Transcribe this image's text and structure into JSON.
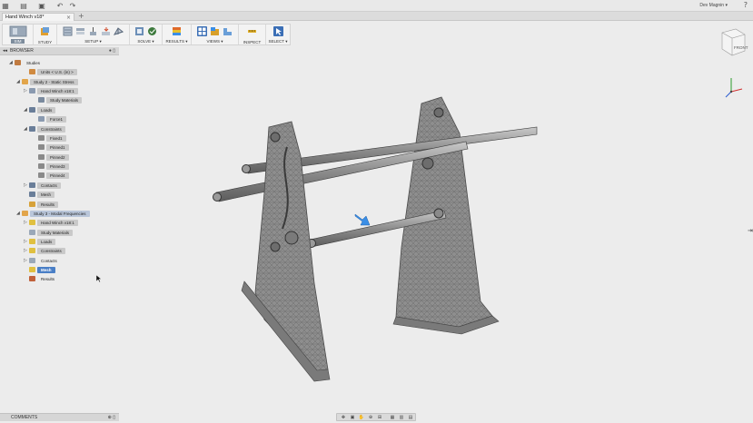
{
  "app": {
    "user_name": "Dev Magnin",
    "user_caret": "▾",
    "help_caret": "▾"
  },
  "document": {
    "tab_title": "Hand Winch v18*",
    "tab_close": "×",
    "new_tab": "+"
  },
  "ribbon": {
    "workspace_label": "SIM",
    "groups": [
      {
        "label": "STUDY"
      },
      {
        "label": "SETUP ▾"
      },
      {
        "label": "SOLVE ▾"
      },
      {
        "label": "RESULTS ▾"
      },
      {
        "label": "VIEWS ▾"
      },
      {
        "label": "INSPECT"
      },
      {
        "label": "SELECT ▾"
      }
    ],
    "accent_color": "#3b6fb6"
  },
  "browser": {
    "title": "BROWSER",
    "tree": [
      {
        "label": "Studies",
        "icon": "studies-icon"
      },
      {
        "label": "Units < U.S. (in) >",
        "icon": "units-icon"
      },
      {
        "label": "Study 2 - Static Stress",
        "icon": "study-icon"
      },
      {
        "label": "Hand Winch v18:1",
        "icon": "component-icon"
      },
      {
        "label": "Study Materials",
        "icon": "materials-icon"
      },
      {
        "label": "Loads",
        "icon": "loads-icon"
      },
      {
        "label": "Force1",
        "icon": "force-icon"
      },
      {
        "label": "Constraints",
        "icon": "constraints-icon"
      },
      {
        "label": "Fixed1",
        "icon": "constraint-icon"
      },
      {
        "label": "Pinned1",
        "icon": "constraint-icon"
      },
      {
        "label": "Pinned2",
        "icon": "constraint-icon"
      },
      {
        "label": "Pinned3",
        "icon": "constraint-icon"
      },
      {
        "label": "Pinned4",
        "icon": "constraint-icon"
      },
      {
        "label": "Contacts",
        "icon": "contacts-icon"
      },
      {
        "label": "Mesh",
        "icon": "mesh-icon"
      },
      {
        "label": "Results",
        "icon": "results-icon"
      },
      {
        "label": "Study 3 - Modal Frequencies",
        "icon": "study-icon"
      },
      {
        "label": "Hand Winch v18:1",
        "icon": "component-icon"
      },
      {
        "label": "Study Materials",
        "icon": "materials-icon"
      },
      {
        "label": "Loads",
        "icon": "loads-icon"
      },
      {
        "label": "Constraints",
        "icon": "constraints-icon"
      },
      {
        "label": "Contacts",
        "icon": "contacts-icon"
      },
      {
        "label": "Mesh",
        "icon": "mesh-icon"
      },
      {
        "label": "Results",
        "icon": "results-icon"
      }
    ]
  },
  "comments": {
    "title": "COMMENTS"
  },
  "viewcube": {
    "face_label": "FRONT"
  },
  "colors": {
    "background": "#ececec",
    "selection": "#4a7fc6",
    "force_arrow": "#3a8ee6"
  }
}
